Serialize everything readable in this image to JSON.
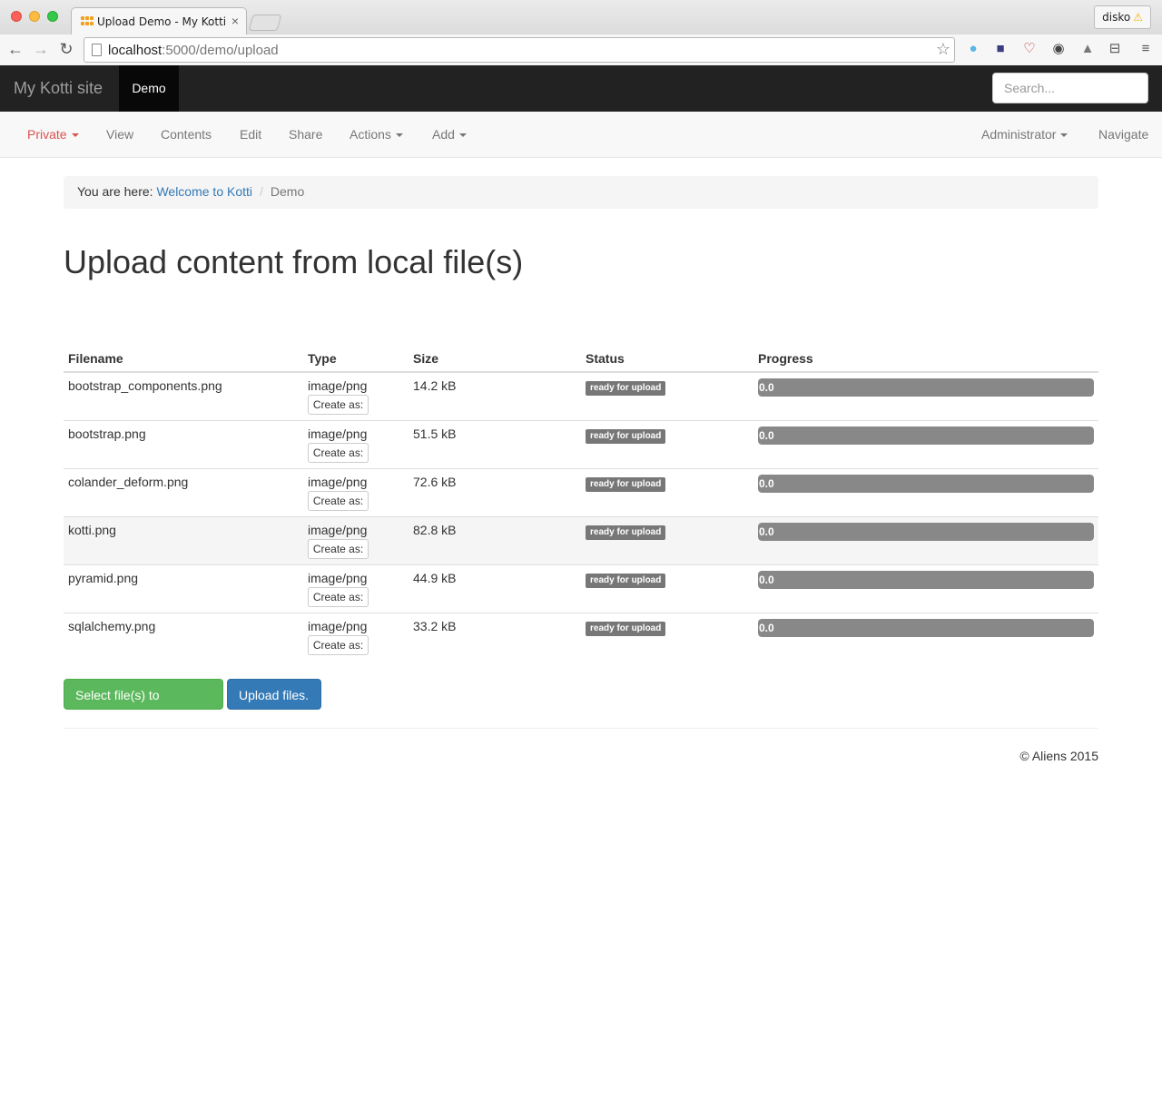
{
  "browser": {
    "tab_title": "Upload Demo - My Kotti site",
    "tab_close": "×",
    "profile_name": "disko",
    "warn_icon": "⚠",
    "url_host": "localhost",
    "url_path": ":5000/demo/upload"
  },
  "navbar": {
    "brand": "My Kotti site",
    "active_item": "Demo",
    "search_placeholder": "Search..."
  },
  "editbar": {
    "private": "Private",
    "view": "View",
    "contents": "Contents",
    "edit": "Edit",
    "share": "Share",
    "actions": "Actions",
    "add": "Add",
    "administrator": "Administrator",
    "navigate": "Navigate"
  },
  "breadcrumb": {
    "prefix": "You are here:",
    "link": "Welcome to Kotti",
    "separator": "/",
    "current": "Demo"
  },
  "page_title": "Upload content from local file(s)",
  "table": {
    "headers": {
      "filename": "Filename",
      "type": "Type",
      "size": "Size",
      "status": "Status",
      "progress": "Progress"
    },
    "rows": [
      {
        "filename": "bootstrap_components.png",
        "type": "image/png",
        "create": "Create as:",
        "size": "14.2 kB",
        "status": "ready for upload",
        "progress": "0.0"
      },
      {
        "filename": "bootstrap.png",
        "type": "image/png",
        "create": "Create as:",
        "size": "51.5 kB",
        "status": "ready for upload",
        "progress": "0.0"
      },
      {
        "filename": "colander_deform.png",
        "type": "image/png",
        "create": "Create as:",
        "size": "72.6 kB",
        "status": "ready for upload",
        "progress": "0.0"
      },
      {
        "filename": "kotti.png",
        "type": "image/png",
        "create": "Create as:",
        "size": "82.8 kB",
        "status": "ready for upload",
        "progress": "0.0"
      },
      {
        "filename": "pyramid.png",
        "type": "image/png",
        "create": "Create as:",
        "size": "44.9 kB",
        "status": "ready for upload",
        "progress": "0.0"
      },
      {
        "filename": "sqlalchemy.png",
        "type": "image/png",
        "create": "Create as:",
        "size": "33.2 kB",
        "status": "ready for upload",
        "progress": "0.0"
      }
    ]
  },
  "buttons": {
    "select": "Select file(s) to upload...",
    "upload": "Upload files."
  },
  "footer": "© Aliens 2015",
  "colors": {
    "navbar_bg": "#222222",
    "private_red": "#d9534f",
    "link_blue": "#337ab7",
    "success_green": "#5cb85c",
    "primary_blue": "#337ab7",
    "badge_gray": "#777777"
  }
}
